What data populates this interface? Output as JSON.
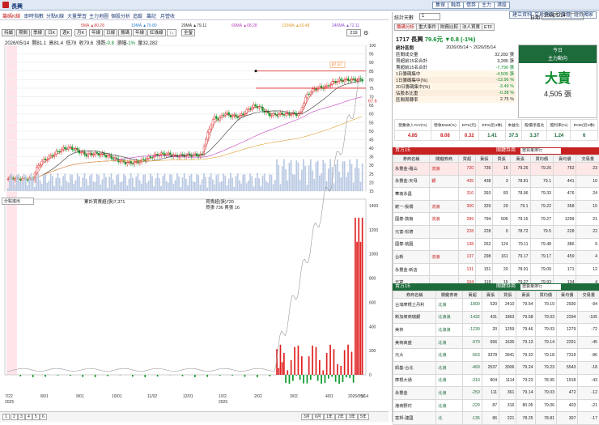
{
  "window": {
    "title": "長興",
    "buttons": [
      "集保",
      "融券",
      "借券",
      "主力",
      "港股"
    ],
    "right_buttons": [
      "建立資料",
      "交易專區",
      "行事曆",
      "證券獨家"
    ]
  },
  "menu": {
    "active": "籌碼K線",
    "items": [
      "籌碼K線",
      "即時指數",
      "分點K線",
      "大量學習",
      "主力地圖",
      "個股分析",
      "追蹤",
      "籌記",
      "月營收"
    ]
  },
  "toolbar": {
    "items": [
      "持續",
      "期間",
      "季線",
      "日K",
      "週K",
      "月K",
      "年線",
      "日線",
      "籌碼",
      "年線",
      "紅綠線",
      "↑↓",
      "全螢"
    ],
    "period_value": "219"
  },
  "ma_legend": [
    {
      "label": "5MA",
      "value": "80.28",
      "color": "#d04040"
    },
    {
      "label": "10MA",
      "value": "79.80",
      "color": "#2f7fd0"
    },
    {
      "label": "20MA",
      "value": "79.11",
      "color": "#303030"
    },
    {
      "label": "60MA",
      "value": "68.28",
      "color": "#c040c0"
    },
    {
      "label": "120MA",
      "value": "60.48",
      "color": "#e0a030"
    },
    {
      "label": "240MA",
      "value": "72.11",
      "color": "#9050d0"
    }
  ],
  "ohlc": {
    "date": "2026/05/14",
    "open_label": "開",
    "open": "81.1",
    "high_label": "高",
    "high": "81.4",
    "low_label": "低",
    "low": "78",
    "close_label": "收",
    "close": "79.6",
    "change_label": "漲跌",
    "change": "-0.8",
    "pct_label": "漲幅",
    "pct": "-1%",
    "vol_label": "量",
    "vol": "32,282"
  },
  "price_flags": {
    "high": "87.67",
    "last": "67.6"
  },
  "sub_indicator": {
    "label": "分點進出",
    "legend1": "累計買賣超(張)7,371",
    "legend2": "買賣超(張)720",
    "legend3": "買張 736 賣張 16"
  },
  "x_dates": [
    "7/22",
    "8/01",
    "9/01",
    "10/01",
    "11/02",
    "12/01",
    "1/02",
    "2/02",
    "3/02",
    "4/01",
    "5/"
  ],
  "x_years": [
    "2025",
    "2026"
  ],
  "last_date": "2026/05/14",
  "bottom_tabs": [
    "1",
    "2",
    "3",
    "4",
    "5",
    "6"
  ],
  "bottom_right": [
    "3月",
    "6月",
    "1年",
    "2年",
    "3年",
    "5年"
  ],
  "panel": {
    "range_label": "統計天數",
    "range_value": "1",
    "date_label": "日期",
    "date_value": "2026/5/14",
    "tabs": [
      "籌碼分析",
      "重大事件",
      "財務比較",
      "法人買賣",
      "ETF"
    ],
    "stock": "1717 長興",
    "price": "79.6元",
    "change": "▼0.8 (-1%)",
    "period": "2026/05/14 ~ 2026/05/14",
    "stats": [
      {
        "label": "統計區間",
        "value": ""
      },
      {
        "label": "區間成交量",
        "value": "32,282 張"
      },
      {
        "label": "買超前15名合計",
        "value": "3,285 張"
      },
      {
        "label": "賣超前15名合計",
        "value": "-7,790 張"
      },
      {
        "label": "1日籌碼集中",
        "value": "-4,505 張"
      },
      {
        "label": "1日籌碼集中(%)",
        "value": "-13.96 %"
      },
      {
        "label": "20日籌碼集中(%)",
        "value": "-3.49 %"
      },
      {
        "label": "佔股本比重",
        "value": "-0.38 %"
      },
      {
        "label": "區間周轉率",
        "value": "2.75 %"
      }
    ],
    "force_title": "今日",
    "force_sub": "主力動向",
    "force_word": "大賣",
    "force_value": "4,505 張",
    "fin_heads": [
      "營業收入YoY(%)",
      "營收MoM(%)",
      "EPS(元)",
      "EPS(近4季)",
      "本益比",
      "股價淨值比",
      "殖利率(%)",
      "ROE(近4季)"
    ],
    "fin_vals": [
      "4.85",
      "8.08",
      "0.32",
      "1.41",
      "37.5",
      "3.37",
      "1.24",
      "6"
    ]
  },
  "buy_table": {
    "title": "買方15",
    "opt_label": "關鍵券商",
    "opt_value": "當買量排行",
    "cols": [
      "券商名稱",
      "關鍵券商",
      "買超",
      "賣張",
      "買張",
      "賣張",
      "買均價",
      "賣均價",
      "交易量",
      "損益(萬)"
    ],
    "rows": [
      [
        "永豐金-羅山",
        "流浪",
        "720",
        "736",
        "16",
        "79.26",
        "79.26",
        "752",
        "23"
      ],
      [
        "永豐金-天母",
        "銀",
        "435",
        "438",
        "3",
        "78.81",
        "79.1",
        "441",
        "10"
      ],
      [
        "華南永昌",
        "",
        "310",
        "393",
        "83",
        "78.96",
        "79.33",
        "476",
        "24"
      ],
      [
        "統一-板橋",
        "流浪",
        "300",
        "329",
        "29",
        "79.1",
        "79.22",
        "358",
        "15"
      ],
      [
        "國泰-敦南",
        "流浪",
        "289",
        "794",
        "505",
        "79.15",
        "79.27",
        "1299",
        "21"
      ],
      [
        "元富-松德",
        "",
        "228",
        "228",
        "0",
        "78.72",
        "79.5",
        "228",
        "22"
      ],
      [
        "國泰-桃園",
        "",
        "138",
        "262",
        "124",
        "79.11",
        "79.48",
        "386",
        "9"
      ],
      [
        "台新",
        "流浪",
        "137",
        "298",
        "161",
        "79.17",
        "79.17",
        "459",
        "4"
      ],
      [
        "永豐金-新店",
        "",
        "131",
        "151",
        "20",
        "78.91",
        "79.09",
        "171",
        "12"
      ],
      [
        "元富",
        "",
        "104",
        "119",
        "15",
        "79.27",
        "79.93",
        "134",
        "4"
      ]
    ]
  },
  "sell_table": {
    "title": "賣方15",
    "opt_label": "關鍵券商",
    "opt_value": "當賣量排行",
    "cols": [
      "券商名稱",
      "關鍵券商",
      "賣超",
      "賣張",
      "買張",
      "賣張",
      "買均價",
      "賣均價",
      "交易量",
      "損益(萬)"
    ],
    "rows": [
      [
        "台灣摩根士丹利",
        "北浪",
        "-1890",
        "520",
        "2410",
        "79.54",
        "79.19",
        "2930",
        "-94"
      ],
      [
        "新加坡商瑞銀",
        "北浪浪",
        "-1432",
        "431",
        "1863",
        "79.58",
        "79.03",
        "2294",
        "-105"
      ],
      [
        "美林",
        "北浪浪",
        "-1239",
        "20",
        "1259",
        "79.46",
        "79.03",
        "1279",
        "-72"
      ],
      [
        "美商高盛",
        "北浪",
        "-979",
        "656",
        "1635",
        "79.13",
        "79.14",
        "2291",
        "-45"
      ],
      [
        "元大",
        "北浪",
        "-563",
        "3378",
        "3941",
        "79.32",
        "79.18",
        "7319",
        "-86"
      ],
      [
        "凱基-台北",
        "北浪",
        "-469",
        "2537",
        "3006",
        "79.24",
        "79.23",
        "5543",
        "-18"
      ],
      [
        "摩根大通",
        "北浪",
        "-310",
        "804",
        "1114",
        "79.23",
        "78.95",
        "1918",
        "-43"
      ],
      [
        "永豐金",
        "北浪",
        "-250",
        "111",
        "361",
        "79.14",
        "79.03",
        "472",
        "-12"
      ],
      [
        "港商野村",
        "北浪",
        "-229",
        "87",
        "316",
        "80.05",
        "79.06",
        "403",
        "-21"
      ],
      [
        "富邦-建國",
        "北",
        "-135",
        "86",
        "221",
        "78.25",
        "78.81",
        "307",
        "-17"
      ]
    ]
  }
}
